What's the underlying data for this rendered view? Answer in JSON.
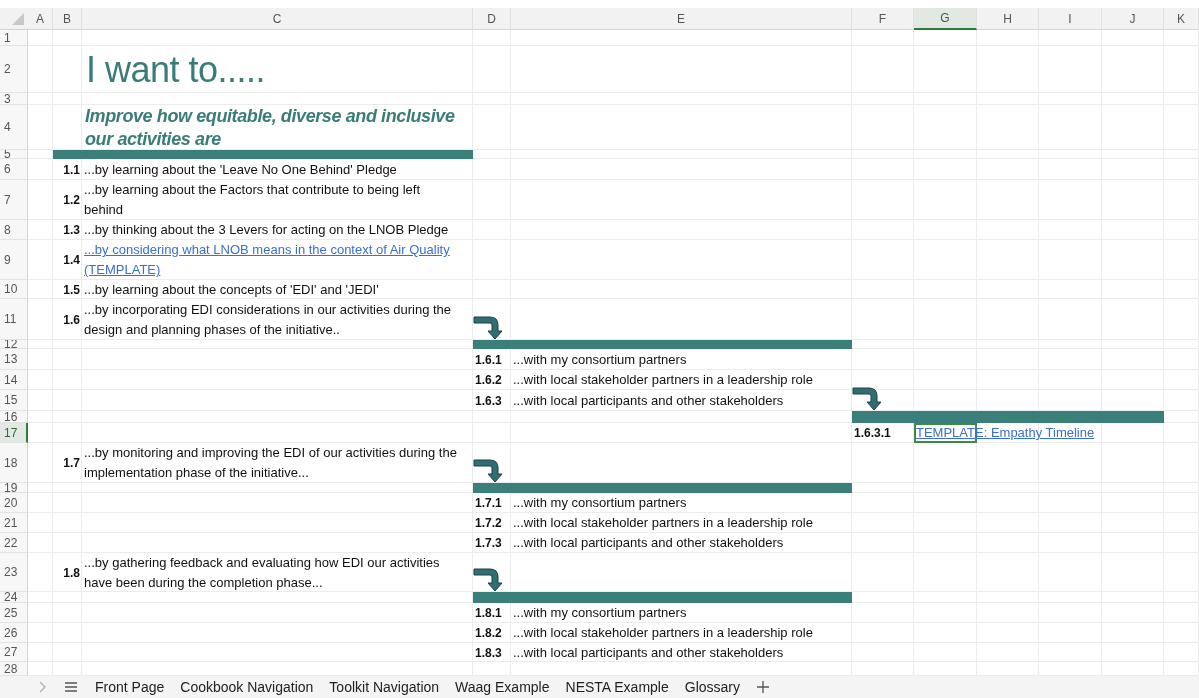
{
  "column_headers": [
    {
      "label": "A",
      "selected": false
    },
    {
      "label": "B",
      "selected": false
    },
    {
      "label": "C",
      "selected": false
    },
    {
      "label": "D",
      "selected": false
    },
    {
      "label": "E",
      "selected": false
    },
    {
      "label": "F",
      "selected": false
    },
    {
      "label": "G",
      "selected": true
    },
    {
      "label": "H",
      "selected": false
    },
    {
      "label": "I",
      "selected": false
    },
    {
      "label": "J",
      "selected": false
    },
    {
      "label": "K",
      "selected": false
    }
  ],
  "row_headers": [
    {
      "label": "1",
      "selected": false
    },
    {
      "label": "2",
      "selected": false
    },
    {
      "label": "3",
      "selected": false
    },
    {
      "label": "4",
      "selected": false
    },
    {
      "label": "5",
      "selected": false
    },
    {
      "label": "6",
      "selected": false
    },
    {
      "label": "7",
      "selected": false
    },
    {
      "label": "8",
      "selected": false
    },
    {
      "label": "9",
      "selected": false
    },
    {
      "label": "10",
      "selected": false
    },
    {
      "label": "11",
      "selected": false
    },
    {
      "label": "12",
      "selected": false
    },
    {
      "label": "13",
      "selected": false
    },
    {
      "label": "14",
      "selected": false
    },
    {
      "label": "15",
      "selected": false
    },
    {
      "label": "16",
      "selected": false
    },
    {
      "label": "17",
      "selected": true
    },
    {
      "label": "18",
      "selected": false
    },
    {
      "label": "19",
      "selected": false
    },
    {
      "label": "20",
      "selected": false
    },
    {
      "label": "21",
      "selected": false
    },
    {
      "label": "22",
      "selected": false
    },
    {
      "label": "23",
      "selected": false
    },
    {
      "label": "24",
      "selected": false
    },
    {
      "label": "25",
      "selected": false
    },
    {
      "label": "26",
      "selected": false
    },
    {
      "label": "27",
      "selected": false
    },
    {
      "label": "28",
      "selected": false
    }
  ],
  "title": "I want to.....",
  "subtitle": "Improve how equitable, diverse and inclusive our activities are",
  "steps": [
    {
      "number": "1.1",
      "text": "...by learning about the 'Leave No One Behind' Pledge",
      "link": false
    },
    {
      "number": "1.2",
      "text": "...by learning about the Factors that contribute to being left behind",
      "link": false
    },
    {
      "number": "1.3",
      "text": "...by thinking about the 3 Levers for acting on the LNOB Pledge",
      "link": false
    },
    {
      "number": "1.4",
      "text": "...by considering what LNOB means in the context of Air Quality (TEMPLATE)",
      "link": true
    },
    {
      "number": "1.5",
      "text": "...by learning about the concepts of  'EDI' and 'JEDI'",
      "link": false
    },
    {
      "number": "1.6",
      "text": "...by incorporating EDI considerations in our activities during the design and planning phases of the initiative..",
      "link": false,
      "substeps": [
        {
          "number": "1.6.1",
          "text": "...with my consortium partners",
          "link": false
        },
        {
          "number": "1.6.2",
          "text": "...with local stakeholder partners in a leadership role",
          "link": false
        },
        {
          "number": "1.6.3",
          "text": "...with local participants and other stakeholders",
          "link": false,
          "substeps": [
            {
              "number": "1.6.3.1",
              "text": "TEMPLATE: Empathy Timeline",
              "link": true
            }
          ]
        }
      ]
    },
    {
      "number": "1.7",
      "text": "...by monitoring and improving the EDI of our activities during the implementation phase of the initiative...",
      "link": false,
      "substeps": [
        {
          "number": "1.7.1",
          "text": "...with my consortium partners",
          "link": false
        },
        {
          "number": "1.7.2",
          "text": "...with local stakeholder partners in a leadership role",
          "link": false
        },
        {
          "number": "1.7.3",
          "text": "...with local participants and other stakeholders",
          "link": false
        }
      ]
    },
    {
      "number": "1.8",
      "text": "...by gathering feedback and evaluating how EDI our activities have been during the completion phase...",
      "link": false,
      "substeps": [
        {
          "number": "1.8.1",
          "text": "...with my consortium partners",
          "link": false
        },
        {
          "number": "1.8.2",
          "text": "...with local stakeholder partners in a leadership role",
          "link": false
        },
        {
          "number": "1.8.3",
          "text": "...with local participants and other stakeholders",
          "link": false
        }
      ]
    }
  ],
  "sheet_tabs": [
    {
      "label": "Front Page",
      "selected": false
    },
    {
      "label": "Cookbook Navigation",
      "selected": false
    },
    {
      "label": "Toolkit Navigation",
      "selected": false
    },
    {
      "label": "Waag Example",
      "selected": false
    },
    {
      "label": "NESTA Example",
      "selected": false
    },
    {
      "label": "Glossary",
      "selected": false
    }
  ]
}
